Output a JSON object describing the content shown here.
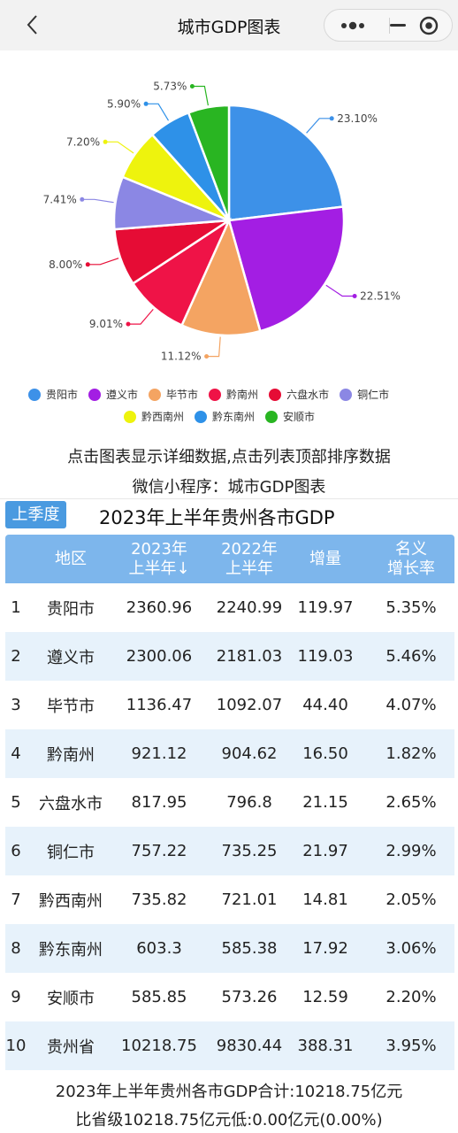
{
  "nav": {
    "title": "城市GDP图表"
  },
  "chart_data": {
    "type": "pie",
    "categories": [
      "贵阳市",
      "遵义市",
      "毕节市",
      "黔南州",
      "六盘水市",
      "铜仁市",
      "黔西南州",
      "黔东南州",
      "安顺市"
    ],
    "values": [
      23.1,
      22.51,
      11.12,
      9.01,
      8.0,
      7.41,
      7.2,
      5.9,
      5.73
    ],
    "labels": [
      "23.10%",
      "22.51%",
      "11.12%",
      "9.01%",
      "8.00%",
      "7.41%",
      "7.20%",
      "5.90%",
      "5.73%"
    ],
    "colors": [
      "#3d91e8",
      "#a31ee3",
      "#f4a462",
      "#ef1347",
      "#e60c35",
      "#8b87e4",
      "#eef30d",
      "#2e91e8",
      "#29b522"
    ],
    "legend_placement": "bottom"
  },
  "legend": {
    "row1": [
      "贵阳市",
      "遵义市",
      "毕节市",
      "黔南州",
      "六盘水市",
      "铜仁市"
    ],
    "row2": [
      "黔西南州",
      "黔东南州",
      "安顺市"
    ]
  },
  "notes": {
    "line1": "点击图表显示详细数据,点击列表顶部排序数据",
    "line2": "微信小程序：城市GDP图表"
  },
  "table": {
    "prev_button": "上季度",
    "title": "2023年上半年贵州各市GDP",
    "headers": {
      "region": "地区",
      "y2023_l1": "2023年",
      "y2023_l2": "上半年",
      "sort_arrow": "↓",
      "y2022_l1": "2022年",
      "y2022_l2": "上半年",
      "increase": "增量",
      "growth_l1": "名义",
      "growth_l2": "增长率"
    },
    "rows": [
      {
        "rank": "1",
        "region": "贵阳市",
        "y2023": "2360.96",
        "y2022": "2240.99",
        "increase": "119.97",
        "growth": "5.35%"
      },
      {
        "rank": "2",
        "region": "遵义市",
        "y2023": "2300.06",
        "y2022": "2181.03",
        "increase": "119.03",
        "growth": "5.46%"
      },
      {
        "rank": "3",
        "region": "毕节市",
        "y2023": "1136.47",
        "y2022": "1092.07",
        "increase": "44.40",
        "growth": "4.07%"
      },
      {
        "rank": "4",
        "region": "黔南州",
        "y2023": "921.12",
        "y2022": "904.62",
        "increase": "16.50",
        "growth": "1.82%"
      },
      {
        "rank": "5",
        "region": "六盘水市",
        "y2023": "817.95",
        "y2022": "796.8",
        "increase": "21.15",
        "growth": "2.65%"
      },
      {
        "rank": "6",
        "region": "铜仁市",
        "y2023": "757.22",
        "y2022": "735.25",
        "increase": "21.97",
        "growth": "2.99%"
      },
      {
        "rank": "7",
        "region": "黔西南州",
        "y2023": "735.82",
        "y2022": "721.01",
        "increase": "14.81",
        "growth": "2.05%"
      },
      {
        "rank": "8",
        "region": "黔东南州",
        "y2023": "603.3",
        "y2022": "585.38",
        "increase": "17.92",
        "growth": "3.06%"
      },
      {
        "rank": "9",
        "region": "安顺市",
        "y2023": "585.85",
        "y2022": "573.26",
        "increase": "12.59",
        "growth": "2.20%"
      },
      {
        "rank": "10",
        "region": "贵州省",
        "y2023": "10218.75",
        "y2022": "9830.44",
        "increase": "388.31",
        "growth": "3.95%"
      }
    ]
  },
  "footer": {
    "line1": "2023年上半年贵州各市GDP合计:10218.75亿元",
    "line2": "比省级10218.75亿元低:0.00亿元(0.00%)"
  }
}
